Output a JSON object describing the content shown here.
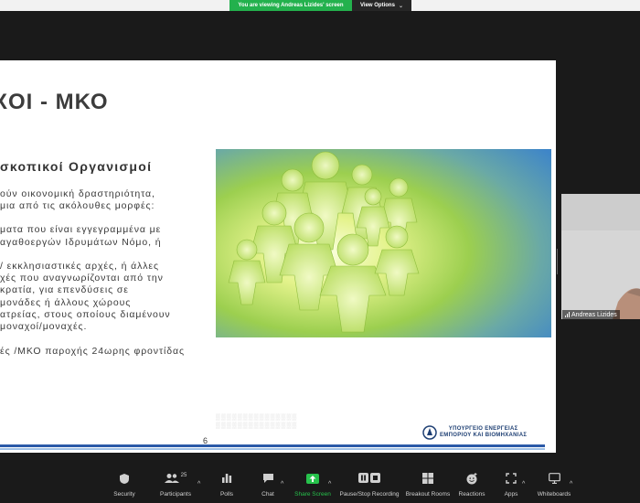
{
  "banner": {
    "viewing_text": "You are viewing Andreas Lizides' screen",
    "view_options": "View Options"
  },
  "slide": {
    "title": "ΧΟΙ - ΜΚΟ",
    "subtitle": "σκοπικοί Οργανισμοί",
    "paragraphs": [
      "ούν οικονομική δραστηριότητα,",
      "μια από τις ακόλουθες μορφές:",
      "ματα που είναι εγγεγραμμένα με",
      "αγαθοεργών Ιδρυμάτων Νόμο, ή",
      "/ εκκλησιαστικές αρχές, ή άλλες",
      "χές που αναγνωρίζονται από την",
      "κρατία, για επενδύσεις σε",
      "μονάδες ή άλλους χώρους",
      "ατρείας, στους οποίους διαμένουν",
      "μοναχοί/μοναχές.",
      "ές /ΜΚΟ παροχής 24ωρης φροντίδας"
    ],
    "page_number": "6",
    "ministry_line1": "ΥΠΟΥΡΓΕΙΟ ΕΝΕΡΓΕΙΑΣ",
    "ministry_line2": "ΕΜΠΟΡΙΟΥ ΚΑΙ ΒΙΟΜΗΧΑΝΙΑΣ",
    "image_icon": "people-circle-illustration"
  },
  "video": {
    "participant_name": "Andreas Lizides",
    "signal_icon": "signal-bars-icon"
  },
  "toolbar": {
    "items": [
      {
        "label": "Security",
        "icon": "shield-icon"
      },
      {
        "label": "Participants",
        "icon": "participants-icon",
        "count": "25"
      },
      {
        "label": "Polls",
        "icon": "polls-icon"
      },
      {
        "label": "Chat",
        "icon": "chat-icon"
      },
      {
        "label": "Share Screen",
        "icon": "share-screen-icon"
      },
      {
        "label": "Pause/Stop Recording",
        "icon": "recording-icon"
      },
      {
        "label": "Breakout Rooms",
        "icon": "breakout-rooms-icon"
      },
      {
        "label": "Reactions",
        "icon": "reactions-icon"
      },
      {
        "label": "Apps",
        "icon": "apps-icon"
      },
      {
        "label": "Whiteboards",
        "icon": "whiteboards-icon"
      }
    ],
    "accent_green": "#27c24c"
  }
}
